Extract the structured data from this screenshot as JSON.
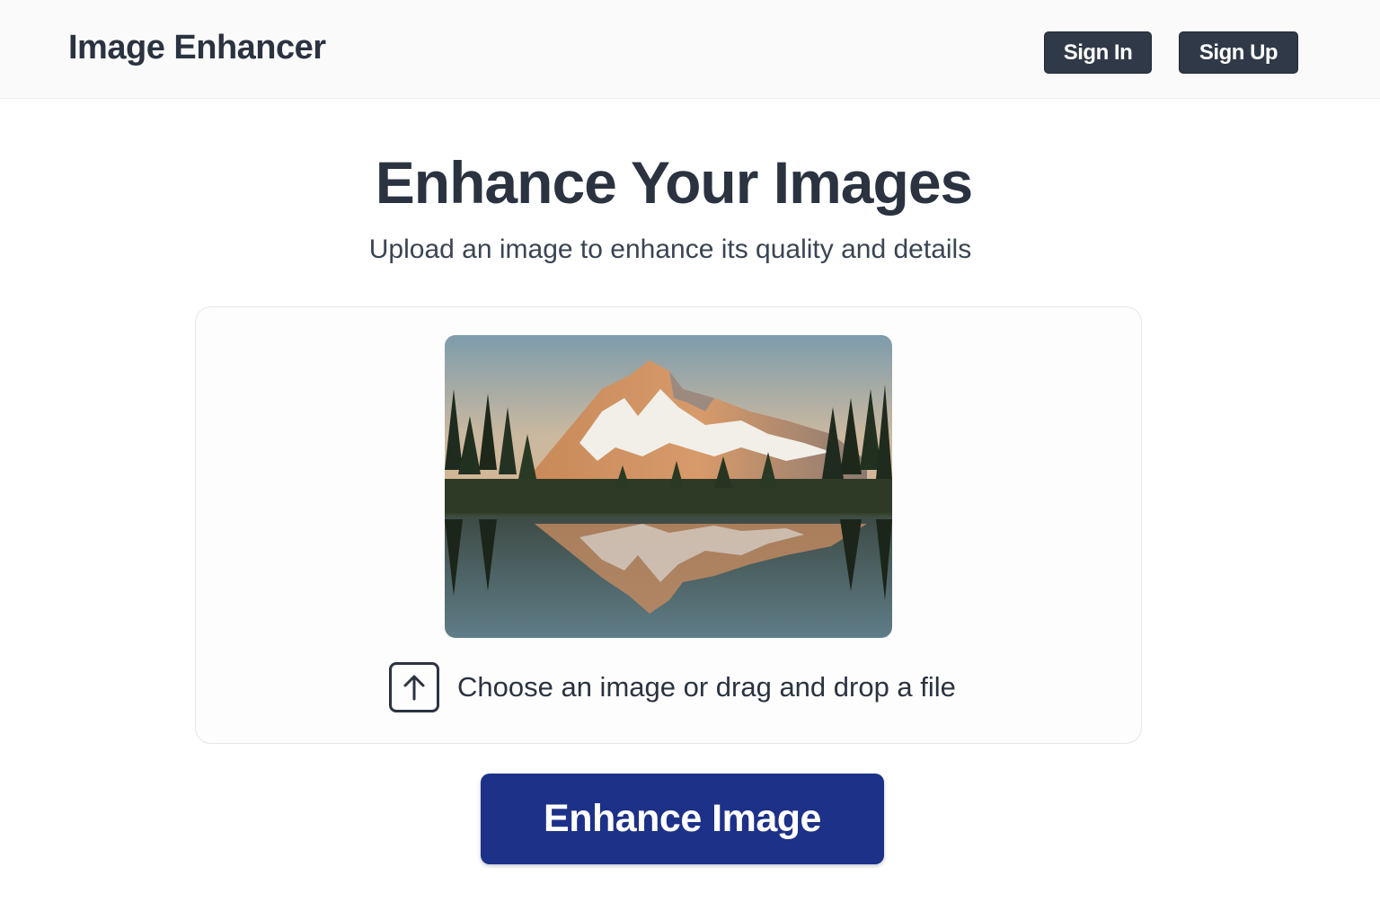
{
  "header": {
    "brand": "Image Enhancer",
    "sign_in_label": "Sign In",
    "sign_up_label": "Sign Up"
  },
  "hero": {
    "title": "Enhance Your Images",
    "subtitle": "Upload an image to enhance its quality and details"
  },
  "upload": {
    "preview_description": "mountain-lake-reflection",
    "icon": "upload-arrow-icon",
    "prompt": "Choose an image or drag and drop a file"
  },
  "actions": {
    "enhance_label": "Enhance Image"
  },
  "colors": {
    "primary": "#1d3188",
    "nav_button": "#2f3947",
    "text": "#2b3341"
  }
}
